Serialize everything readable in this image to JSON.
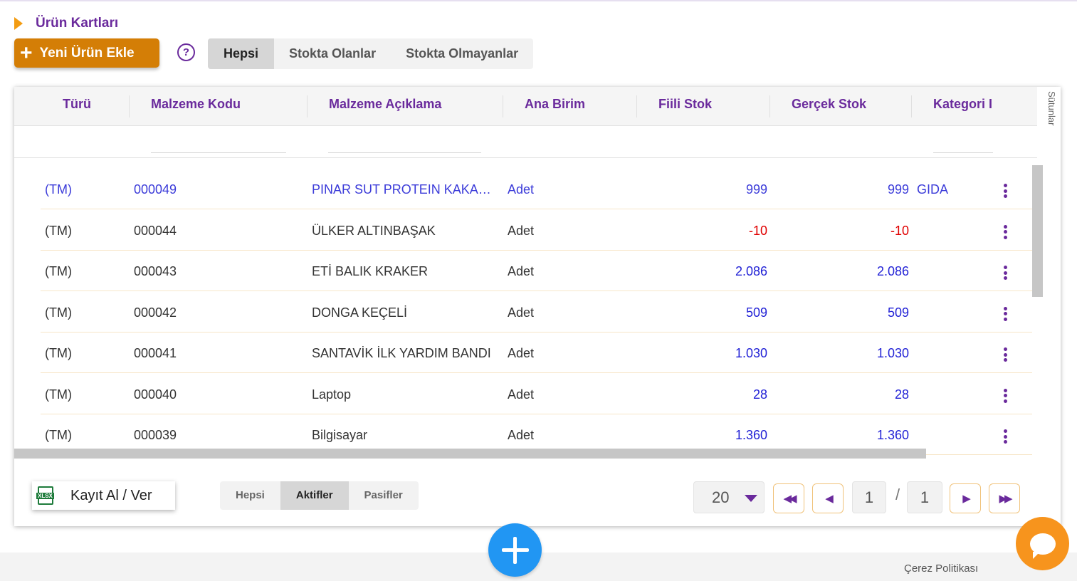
{
  "page": {
    "title": "Ürün Kartları"
  },
  "toolbar": {
    "add_label": "Yeni Ürün Ekle",
    "help_label": "?",
    "tabs": [
      "Hepsi",
      "Stokta Olanlar",
      "Stokta Olmayanlar"
    ],
    "active_tab": "Hepsi"
  },
  "table": {
    "side_label": "Sütunlar",
    "columns": [
      "Türü",
      "Malzeme Kodu",
      "Malzeme Açıklama",
      "Ana Birim",
      "Fiili Stok",
      "Gerçek Stok",
      "Kategori I"
    ],
    "rows": [
      {
        "turu": "(TM)",
        "kod": "000049",
        "aciklama": "PINAR SUT PROTEIN KAKAOLU",
        "birim": "Adet",
        "fiili": "999",
        "gercek": "999",
        "kategori": "GIDA",
        "sign": "pos"
      },
      {
        "turu": "(TM)",
        "kod": "000044",
        "aciklama": "ÜLKER ALTINBAŞAK",
        "birim": "Adet",
        "fiili": "-10",
        "gercek": "-10",
        "kategori": "",
        "sign": "neg"
      },
      {
        "turu": "(TM)",
        "kod": "000043",
        "aciklama": "ETİ BALIK KRAKER",
        "birim": "Adet",
        "fiili": "2.086",
        "gercek": "2.086",
        "kategori": "",
        "sign": "pos"
      },
      {
        "turu": "(TM)",
        "kod": "000042",
        "aciklama": "DONGA KEÇELİ",
        "birim": "Adet",
        "fiili": "509",
        "gercek": "509",
        "kategori": "",
        "sign": "pos"
      },
      {
        "turu": "(TM)",
        "kod": "000041",
        "aciklama": "SANTAVİK İLK YARDIM BANDI",
        "birim": "Adet",
        "fiili": "1.030",
        "gercek": "1.030",
        "kategori": "",
        "sign": "pos"
      },
      {
        "turu": "(TM)",
        "kod": "000040",
        "aciklama": "Laptop",
        "birim": "Adet",
        "fiili": "28",
        "gercek": "28",
        "kategori": "",
        "sign": "pos"
      },
      {
        "turu": "(TM)",
        "kod": "000039",
        "aciklama": "Bilgisayar",
        "birim": "Adet",
        "fiili": "1.360",
        "gercek": "1.360",
        "kategori": "",
        "sign": "pos"
      }
    ]
  },
  "footer": {
    "export_label": "Kayıt Al / Ver",
    "export_icon_text": "XLSX",
    "status_tabs": [
      "Hepsi",
      "Aktifler",
      "Pasifler"
    ],
    "active_status": "Aktifler",
    "page_size": "20",
    "current_page": "1",
    "page_separator": "/",
    "total_pages": "1"
  },
  "bottom": {
    "cookie_label": "Çerez Politikası"
  },
  "colors": {
    "accent": "#6a2a9c",
    "orange": "#d47e06",
    "blue": "#2196f3",
    "positive": "#2323d6",
    "negative": "#e00000"
  },
  "icons": [
    "plus-icon",
    "help-icon",
    "kebab-icon",
    "xlsx-file-icon",
    "caret-down-icon",
    "first-page-icon",
    "prev-page-icon",
    "next-page-icon",
    "last-page-icon",
    "chat-icon"
  ]
}
